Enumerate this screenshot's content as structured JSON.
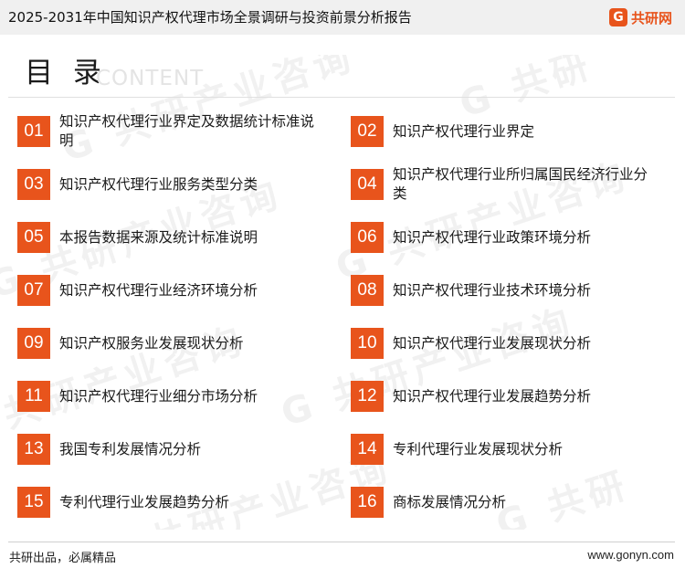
{
  "header": {
    "report_title": "2025-2031年中国知识产权代理市场全景调研与投资前景分析报告",
    "brand_name": "共研网",
    "brand_mark": "G"
  },
  "heading": {
    "title": "目 录",
    "subtitle": "CONTENT"
  },
  "toc": [
    {
      "num": "01",
      "label": "知识产权代理行业界定及数据统计标准说明"
    },
    {
      "num": "02",
      "label": "知识产权代理行业界定"
    },
    {
      "num": "03",
      "label": "知识产权代理行业服务类型分类"
    },
    {
      "num": "04",
      "label": "知识产权代理行业所归属国民经济行业分类"
    },
    {
      "num": "05",
      "label": "本报告数据来源及统计标准说明"
    },
    {
      "num": "06",
      "label": "知识产权代理行业政策环境分析"
    },
    {
      "num": "07",
      "label": "知识产权代理行业经济环境分析"
    },
    {
      "num": "08",
      "label": "知识产权代理行业技术环境分析"
    },
    {
      "num": "09",
      "label": "知识产权服务业发展现状分析"
    },
    {
      "num": "10",
      "label": "知识产权代理行业发展现状分析"
    },
    {
      "num": "11",
      "label": "知识产权代理行业细分市场分析"
    },
    {
      "num": "12",
      "label": "知识产权代理行业发展趋势分析"
    },
    {
      "num": "13",
      "label": "我国专利发展情况分析"
    },
    {
      "num": "14",
      "label": "专利代理行业发展现状分析"
    },
    {
      "num": "15",
      "label": "专利代理行业发展趋势分析"
    },
    {
      "num": "16",
      "label": "商标发展情况分析"
    }
  ],
  "footer": {
    "slogan": "共研出品，必属精品",
    "website": "www.gonyn.com"
  },
  "colors": {
    "accent": "#e8541c",
    "topbar": "#f0f0f0"
  }
}
